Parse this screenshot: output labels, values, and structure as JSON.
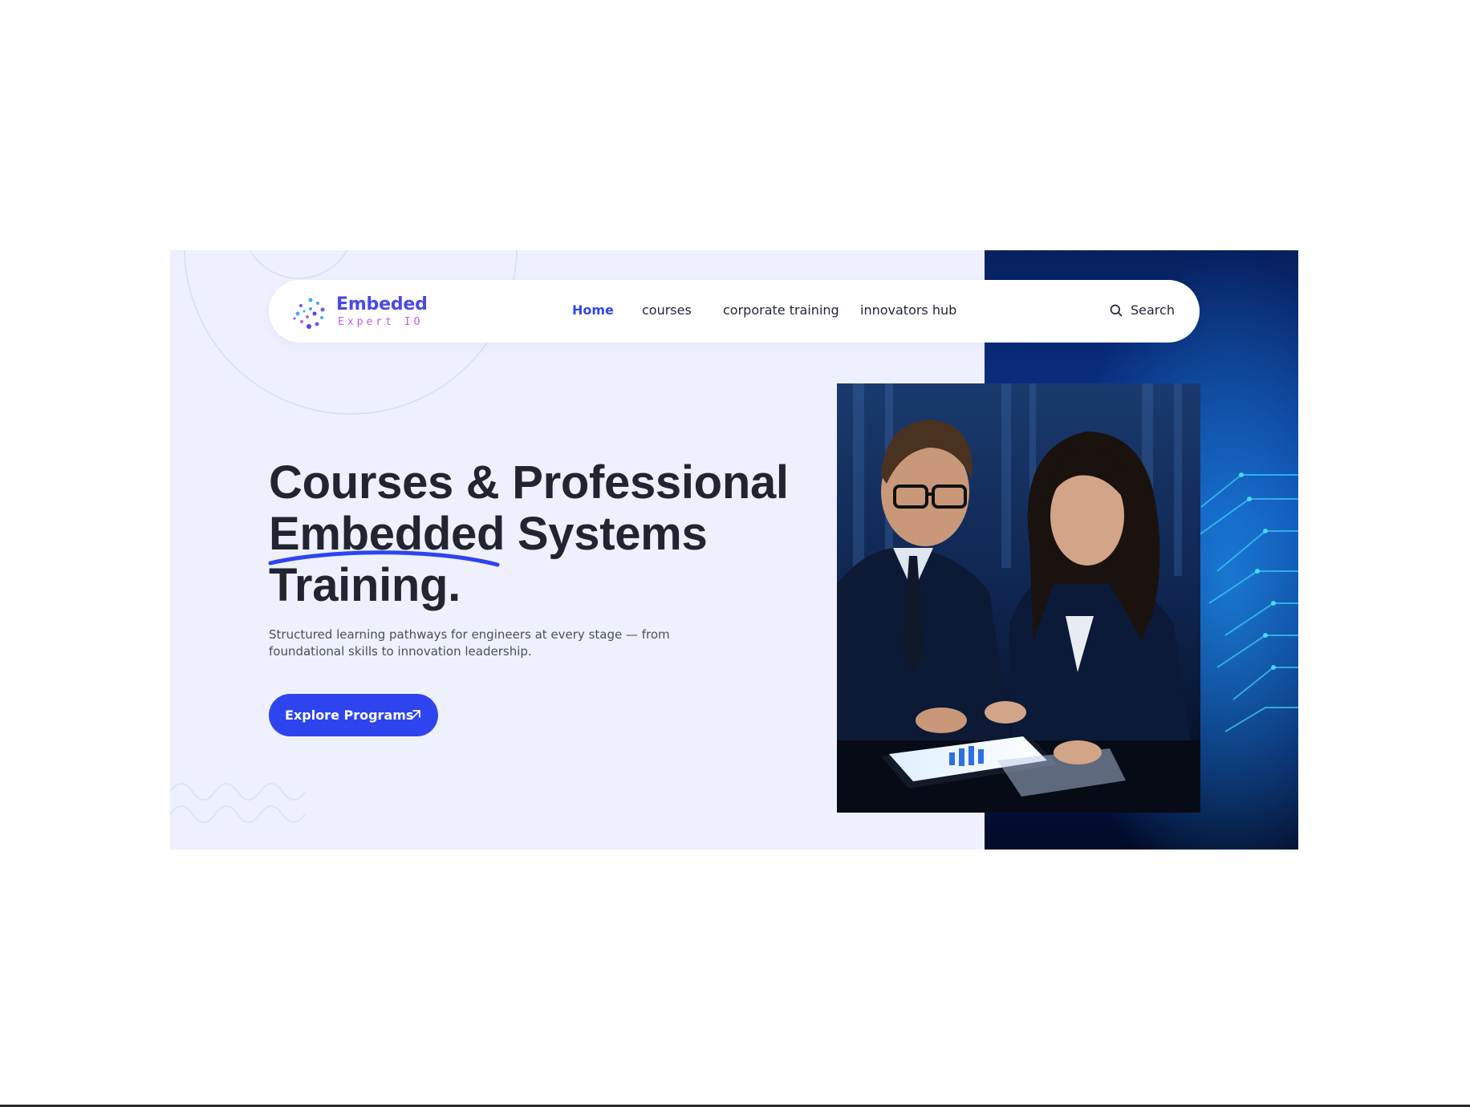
{
  "brand": {
    "name": "Embeded",
    "tagline": "Expert IO",
    "primary_color": "#2e44ef",
    "accent_color": "#c25ae6"
  },
  "nav": {
    "items": [
      {
        "label": "Home",
        "active": true
      },
      {
        "label": "courses",
        "active": false
      },
      {
        "label": "corporate training",
        "active": false
      },
      {
        "label": "innovators hub",
        "active": false
      }
    ],
    "search_label": "Search"
  },
  "hero": {
    "headline": {
      "line1": "Courses & Professional",
      "line2_highlight": "Embedded",
      "line2_rest": " Systems",
      "line3": "Training."
    },
    "subtext": "Structured learning pathways for engineers at every stage — from foundational skills  to innovation leadership.",
    "cta_label": "Explore Programs",
    "cta_icon": "arrow-up-right-icon",
    "image_subject": "two professionals reviewing charts on a tablet"
  }
}
